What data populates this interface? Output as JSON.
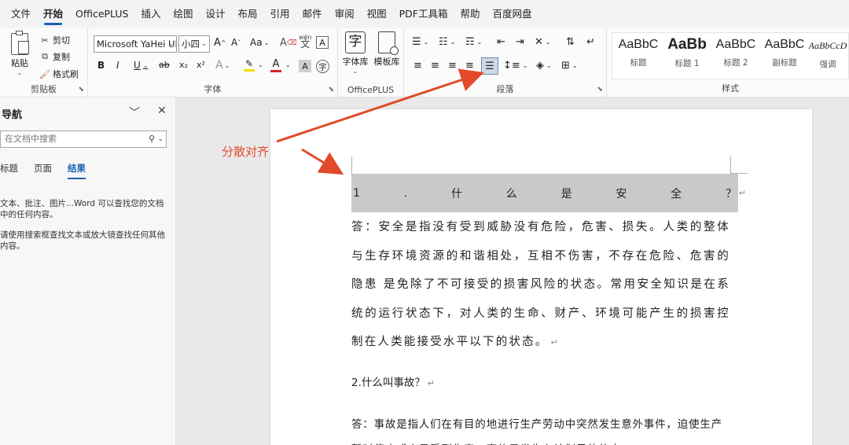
{
  "menu": [
    "文件",
    "开始",
    "OfficePLUS",
    "插入",
    "绘图",
    "设计",
    "布局",
    "引用",
    "邮件",
    "审阅",
    "视图",
    "PDF工具箱",
    "帮助",
    "百度网盘"
  ],
  "menu_active_index": 1,
  "ribbon": {
    "clipboard": {
      "paste": "粘贴",
      "cut": "剪切",
      "copy": "复制",
      "format_painter": "格式刷",
      "label": "剪贴板"
    },
    "font": {
      "font_name": "Microsoft YaHei UI",
      "font_size": "小四",
      "label": "字体",
      "grow": "A^",
      "shrink": "Aˇ",
      "case": "Aa",
      "bold": "B",
      "italic": "I",
      "underline": "U",
      "strike": "ab",
      "sub": "x₂",
      "sup": "x²",
      "font_color": "A",
      "highlight": "A",
      "clear": "A",
      "phonetic": "wén",
      "border_char": "A",
      "enclose": "字"
    },
    "officeplus": {
      "font_lib": "字体库",
      "template_lib": "模板库",
      "label": "OfficePLUS",
      "font_icon": "字"
    },
    "paragraph": {
      "label": "段落"
    },
    "styles": {
      "label": "样式",
      "items": [
        {
          "sample": "AaBbC",
          "name": "标题"
        },
        {
          "sample": "AaBb",
          "name": "标题 1"
        },
        {
          "sample": "AaBbC",
          "name": "标题 2"
        },
        {
          "sample": "AaBbC",
          "name": "副标题"
        },
        {
          "sample": "AaBbCcD",
          "name": "强调"
        }
      ]
    }
  },
  "nav": {
    "title": "导航",
    "search_placeholder": "在文档中搜索",
    "tabs": [
      "标题",
      "页面",
      "结果"
    ],
    "active_tab": 2,
    "hint1": "文本、批注、图片...Word 可以查找您的文档中的任何内容。",
    "hint2": "请使用搜索框查找文本或放大镜查找任何其他内容。"
  },
  "annotation": "分散对齐",
  "document": {
    "line1_chars": [
      "1",
      ".",
      "什",
      "么",
      "是",
      "安",
      "全",
      "？"
    ],
    "answer1": "答：安全是指没有受到威胁没有危险，危害、损失。人类的整体与生存环境资源的和谐相处，互相不伤害，不存在危险、危害的隐患 是免除了不可接受的损害风险的状态。常用安全知识是在系统的运行状态下，对人类的生命、财产、环境可能产生的损害控制在人类能接受水平以下的状态。",
    "q2": "2.什么叫事故？",
    "answer2": "答：事故是指人们在有目的地进行生产劳动中突然发生意外事件，迫使生产暂时停止或人员受到伤害，事故是发生在计划目的的中"
  },
  "colors": {
    "accent": "#1a5fb4",
    "annotation": "#e24a2b",
    "selection": "#c9c9c9"
  }
}
